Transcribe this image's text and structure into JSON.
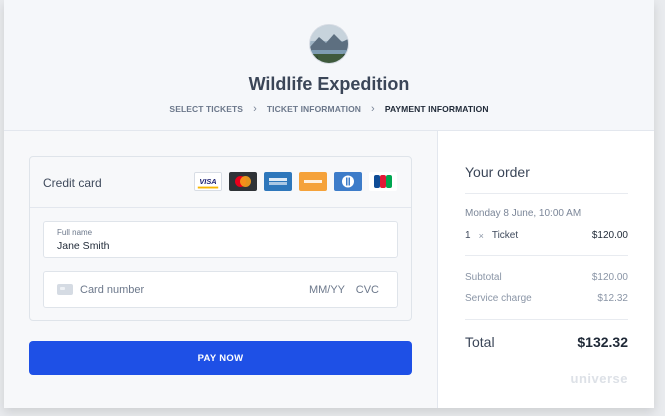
{
  "event": {
    "title": "Wildlife Expedition",
    "image": "mountain-lake-avatar"
  },
  "breadcrumb": {
    "steps": [
      "SELECT TICKETS",
      "TICKET INFORMATION",
      "PAYMENT INFORMATION"
    ],
    "active_index": 2
  },
  "payment": {
    "section_label": "Credit card",
    "card_brands": [
      "visa",
      "mastercard",
      "american-express",
      "discover",
      "diners-club",
      "jcb"
    ],
    "full_name": {
      "label": "Full name",
      "value": "Jane Smith"
    },
    "card_number": {
      "placeholder": "Card number"
    },
    "expiry": {
      "placeholder": "MM/YY"
    },
    "cvc": {
      "placeholder": "CVC"
    },
    "submit_label": "PAY NOW"
  },
  "order": {
    "title": "Your order",
    "date": "Monday 8 June, 10:00 AM",
    "items": [
      {
        "quantity": "1",
        "times": "×",
        "name": "Ticket",
        "price": "$120.00"
      }
    ],
    "subtotal": {
      "label": "Subtotal",
      "value": "$120.00"
    },
    "service_charge": {
      "label": "Service charge",
      "value": "$12.32"
    },
    "total": {
      "label": "Total",
      "value": "$132.32"
    },
    "brand": "universe"
  },
  "colors": {
    "primary_button": "#1e50e6",
    "header_bg": "#f5f7fa"
  }
}
